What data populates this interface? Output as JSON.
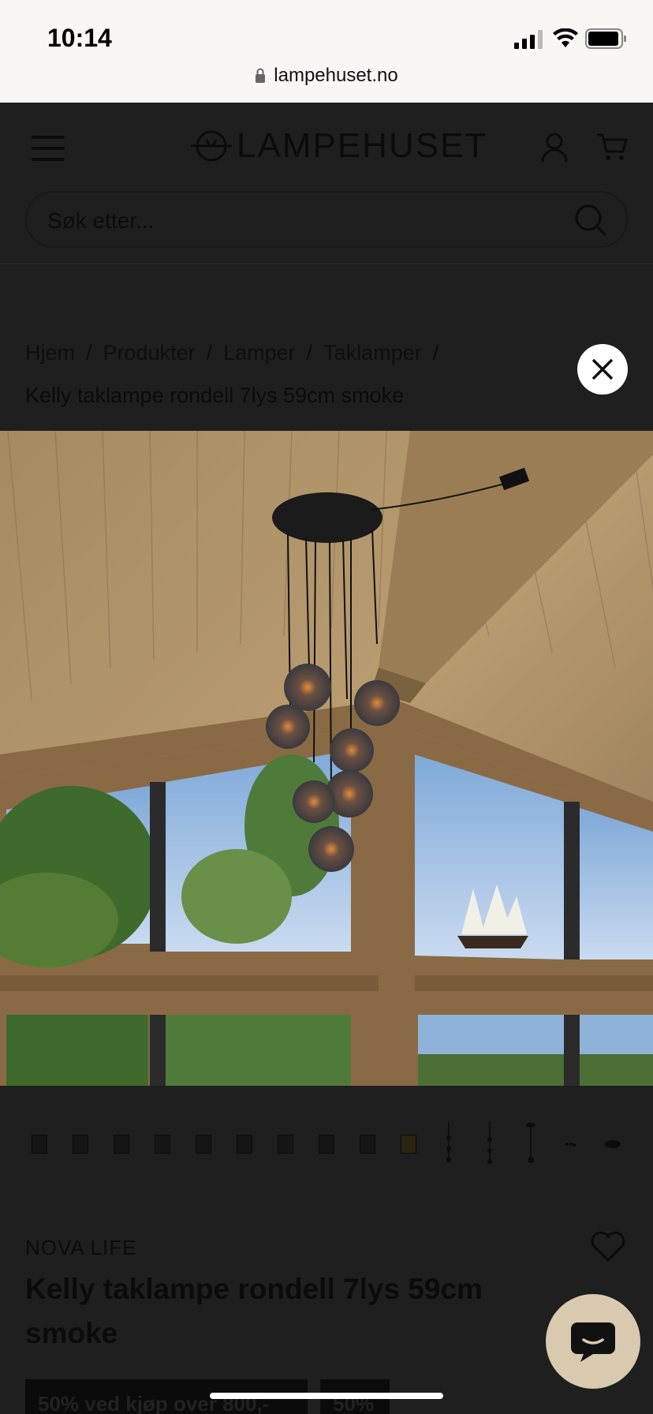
{
  "status": {
    "time": "10:14",
    "url": "lampehuset.no"
  },
  "header": {
    "logo_text": "LAMPEHUSET",
    "search_placeholder": "Søk etter..."
  },
  "breadcrumb": {
    "items": [
      "Hjem",
      "Produkter",
      "Lamper",
      "Taklamper"
    ],
    "separator": "/",
    "current": "Kelly taklampe rondell 7lys 59cm smoke"
  },
  "product": {
    "brand": "NOVA LIFE",
    "title": "Kelly taklampe rondell 7lys 59cm smoke",
    "badge_offer": "50% ved kjøp over 800,-",
    "badge_discount": "50%"
  },
  "colors": {
    "overlay_bg": "#1f1f1f",
    "chat_button": "#d9c9ae",
    "statusbar_bg": "#f8f7f4"
  },
  "icons": [
    "lock-icon",
    "menu-icon",
    "user-icon",
    "cart-icon",
    "search-icon",
    "close-icon",
    "heart-icon",
    "chat-icon"
  ]
}
